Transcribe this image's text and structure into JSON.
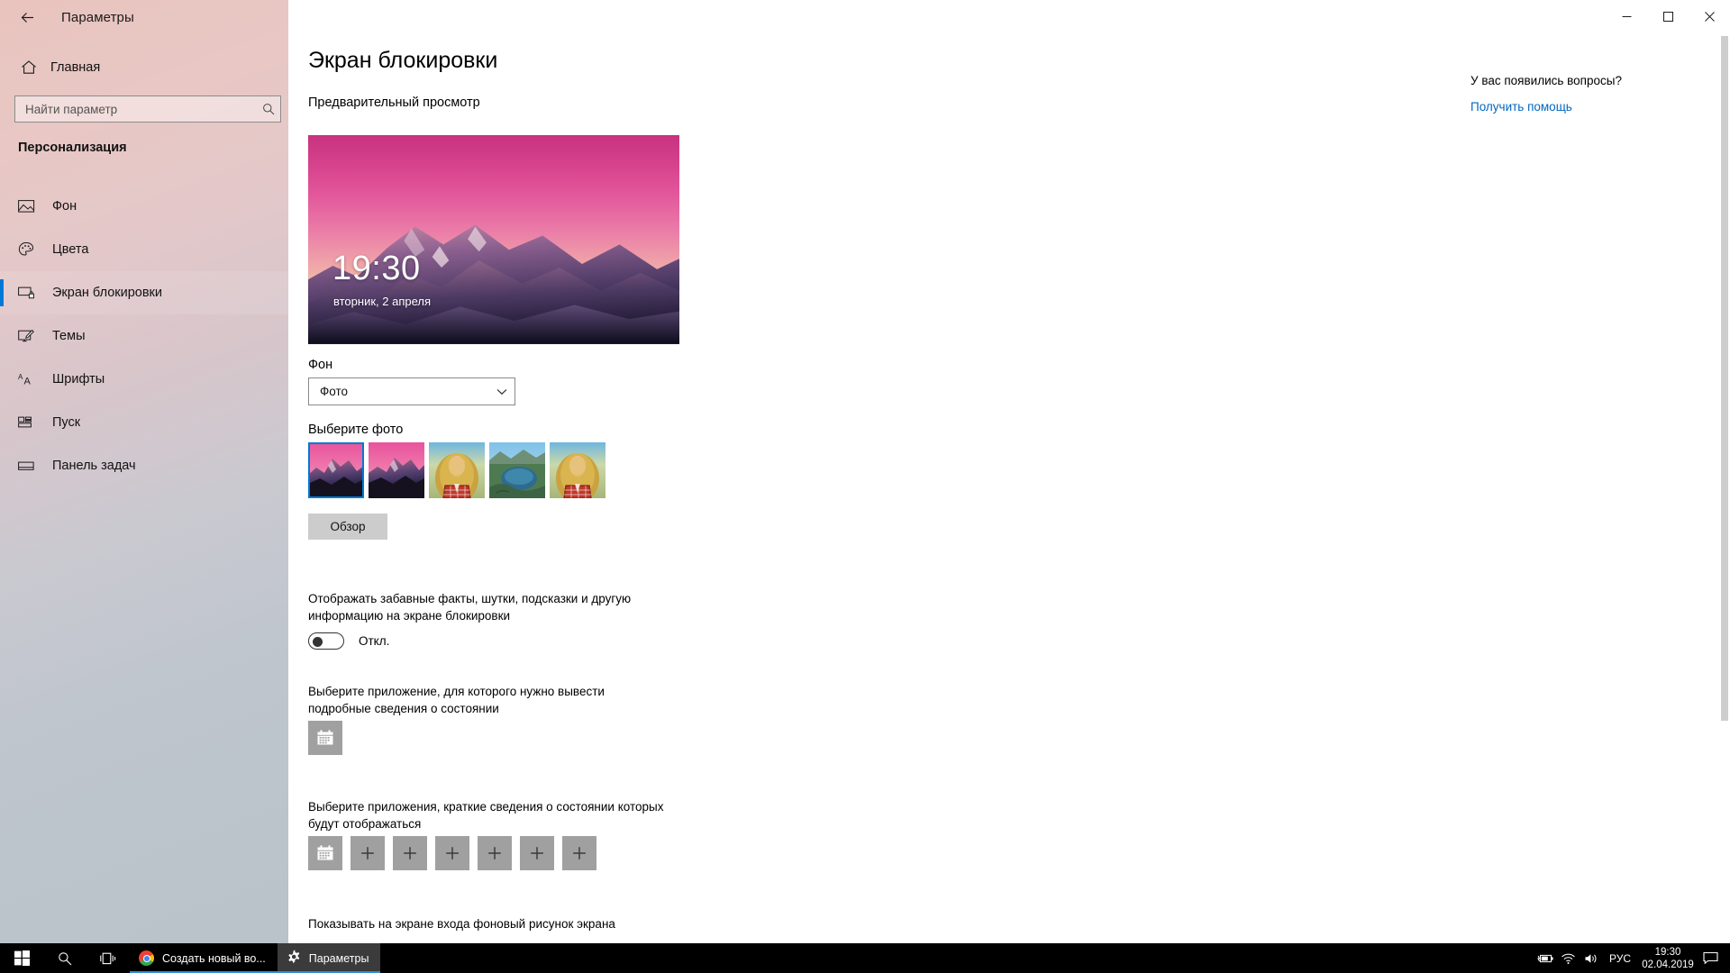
{
  "window": {
    "title": "Параметры",
    "back_icon": "back-arrow-icon",
    "minimize_glyph": "─",
    "maximize_glyph": "❐",
    "close_glyph": "✕"
  },
  "nav": {
    "home_label": "Главная",
    "home_icon": "home-icon",
    "search": {
      "placeholder": "Найти параметр",
      "value": "",
      "icon": "search-icon"
    },
    "section_title": "Персонализация",
    "items": [
      {
        "label": "Фон",
        "icon": "picture-icon",
        "selected": false
      },
      {
        "label": "Цвета",
        "icon": "palette-icon",
        "selected": false
      },
      {
        "label": "Экран блокировки",
        "icon": "lockscreen-icon",
        "selected": true
      },
      {
        "label": "Темы",
        "icon": "theme-brush-icon",
        "selected": false
      },
      {
        "label": "Шрифты",
        "icon": "fonts-aa-icon",
        "selected": false
      },
      {
        "label": "Пуск",
        "icon": "start-tiles-icon",
        "selected": false
      },
      {
        "label": "Панель задач",
        "icon": "taskbar-icon",
        "selected": false
      }
    ]
  },
  "main": {
    "page_title": "Экран блокировки",
    "preview_label": "Предварительный просмотр",
    "preview": {
      "time": "19:30",
      "date": "вторник, 2 апреля"
    },
    "background_label": "Фон",
    "background_select": {
      "value": "Фото",
      "arrow_icon": "chevron-down-icon"
    },
    "choose_photo_label": "Выберите фото",
    "thumbnails": [
      {
        "name": "mountain-sunset-1",
        "selected": true
      },
      {
        "name": "mountain-sunset-2",
        "selected": false
      },
      {
        "name": "woman-portrait-1",
        "selected": false
      },
      {
        "name": "lake-valley",
        "selected": false
      },
      {
        "name": "woman-portrait-2",
        "selected": false
      }
    ],
    "browse_button": "Обзор",
    "fun_facts_text": "Отображать забавные факты, шутки, подсказки и другую информацию на экране блокировки",
    "fun_facts_toggle": {
      "state": "Откл.",
      "on": false
    },
    "detailed_status_text": "Выберите приложение, для которого нужно вывести подробные сведения о состоянии",
    "detailed_status_tile": {
      "icon": "calendar-icon"
    },
    "quick_status_text": "Выберите приложения, краткие сведения о состоянии которых будут отображаться",
    "quick_status_tiles": [
      {
        "icon": "calendar-icon",
        "empty": false
      },
      {
        "icon": "plus-icon",
        "empty": true
      },
      {
        "icon": "plus-icon",
        "empty": true
      },
      {
        "icon": "plus-icon",
        "empty": true
      },
      {
        "icon": "plus-icon",
        "empty": true
      },
      {
        "icon": "plus-icon",
        "empty": true
      },
      {
        "icon": "plus-icon",
        "empty": true
      }
    ],
    "bottom_text": "Показывать на экране входа фоновый рисунок экрана"
  },
  "help": {
    "question": "У вас появились вопросы?",
    "link": "Получить помощь"
  },
  "taskbar": {
    "start_icon": "windows-start-icon",
    "search_icon": "search-icon",
    "taskview_icon": "task-view-icon",
    "apps": [
      {
        "label": "Создать новый во...",
        "icon": "chrome-icon",
        "active": false
      },
      {
        "label": "Параметры",
        "icon": "gear-icon",
        "active": true
      }
    ],
    "tray": {
      "battery_icon": "battery-charging-icon",
      "network_icon": "wifi-icon",
      "volume_icon": "speaker-icon",
      "language": "РУС",
      "time": "19:30",
      "date": "02.04.2019",
      "notification_icon": "notification-icon"
    }
  },
  "colors": {
    "accent": "#0078d7",
    "link": "#0067c0",
    "tile_gray": "#a0a0a0",
    "button_gray": "#cccccc"
  }
}
